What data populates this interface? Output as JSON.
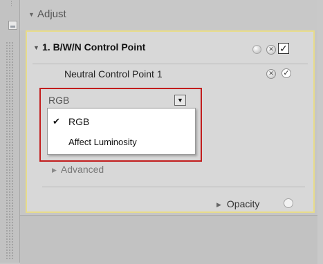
{
  "adjust": {
    "title": "Adjust"
  },
  "control_point": {
    "title": "1. B/W/N Control Point",
    "enabled": true,
    "delete_symbol": "✕",
    "check_symbol": "✓"
  },
  "neutral_point": {
    "label": "Neutral Control Point 1",
    "delete_symbol": "✕",
    "check_symbol": "✓"
  },
  "mode_select": {
    "selected": "RGB",
    "arrow_symbol": "▼",
    "options": [
      {
        "label": "RGB",
        "checked": true,
        "mark": "✔"
      },
      {
        "label": "Affect Luminosity",
        "checked": false,
        "mark": ""
      }
    ]
  },
  "advanced": {
    "label": "Advanced"
  },
  "opacity": {
    "label": "Opacity"
  },
  "colors": {
    "highlight_border": "#c21d1d",
    "panel_border": "#e8dc8a"
  }
}
